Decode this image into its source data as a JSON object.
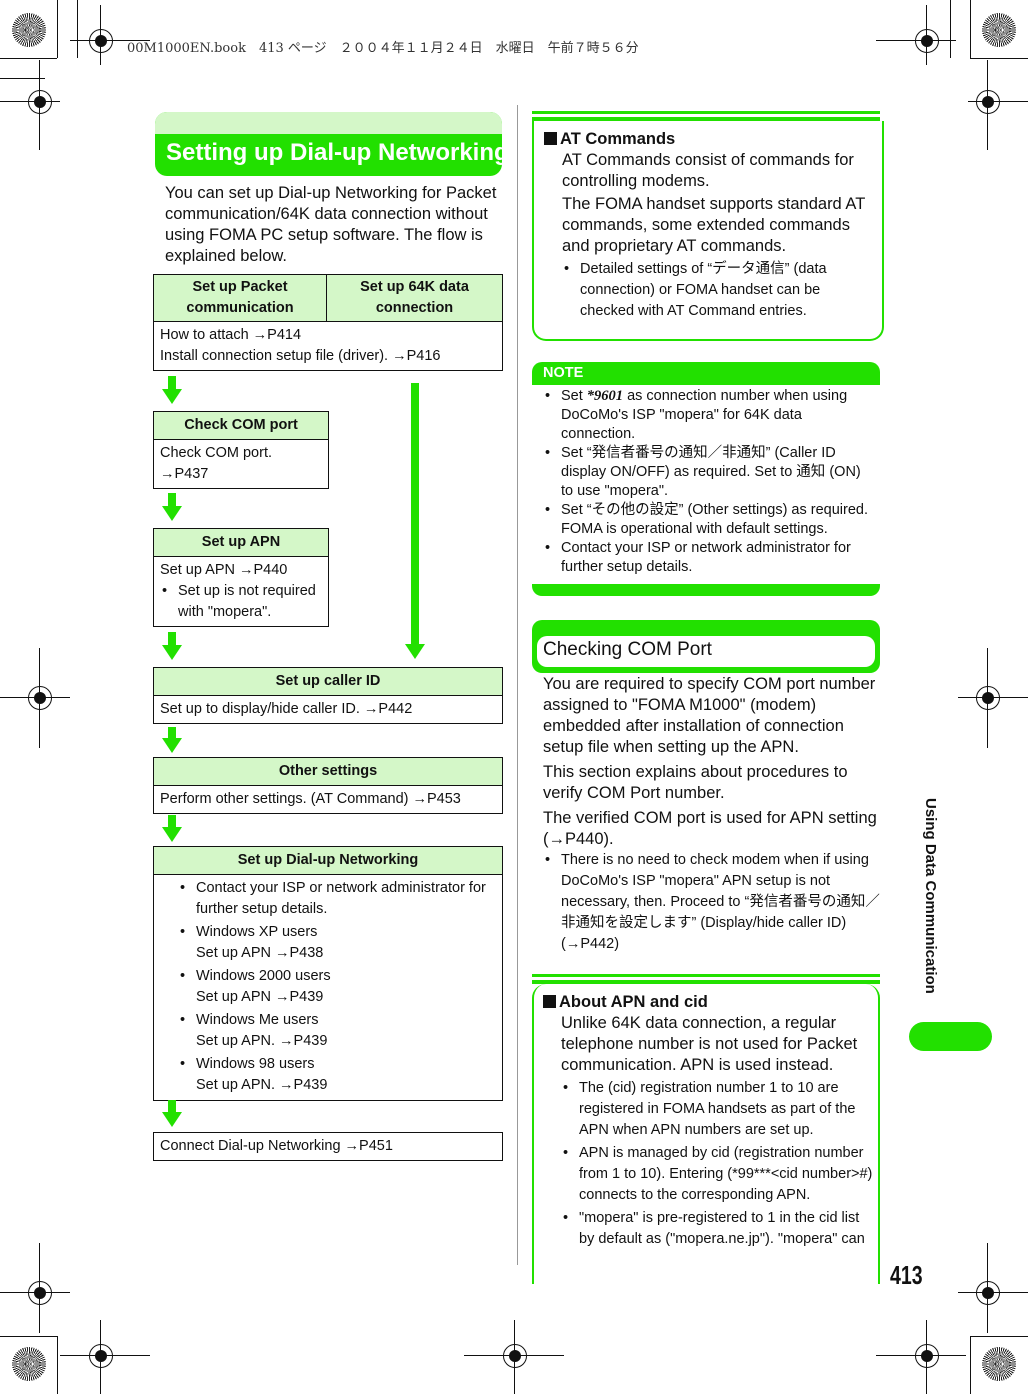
{
  "print_header": "00M1000EN.book　413 ページ　２００４年１１月２４日　水曜日　午前７時５６分",
  "title": "Setting up Dial-up Networking",
  "intro": "You can set up Dial-up Networking for Packet communication/64K data connection without using FOMA PC setup software. The flow is explained below.",
  "flow": {
    "start": {
      "col1": "Set up Packet communication",
      "col2": "Set up 64K data connection",
      "lines": [
        "How to attach →P414",
        "Install connection setup file (driver). →P416"
      ]
    },
    "com": {
      "head": "Check COM port",
      "lines": [
        "Check COM port.",
        "→P437"
      ]
    },
    "apn": {
      "head": "Set up APN",
      "line": "Set up APN →P440",
      "bullet": "Set up is not required with \"mopera\"."
    },
    "caller": {
      "head": "Set up caller ID",
      "line": "Set up to display/hide caller ID. →P442"
    },
    "other": {
      "head": "Other settings",
      "line": "Perform other settings. (AT Command) →P453"
    },
    "dialup": {
      "head": "Set up Dial-up Networking",
      "items": [
        {
          "a": "Contact your ISP or network administrator for further setup details.",
          "b": ""
        },
        {
          "a": "Windows XP users",
          "b": "Set up APN →P438"
        },
        {
          "a": "Windows 2000 users",
          "b": "Set up APN →P439"
        },
        {
          "a": "Windows Me users",
          "b": "Set up APN. →P439"
        },
        {
          "a": "Windows 98 users",
          "b": "Set up APN. →P439"
        }
      ]
    },
    "connect": "Connect Dial-up Networking →P451"
  },
  "at": {
    "head": "AT Commands",
    "p1": "AT Commands consist of commands for controlling modems.",
    "p2": "The FOMA handset supports standard AT commands, some extended commands and proprietary AT commands.",
    "bullet": "Detailed settings of “データ通信” (data connection) or FOMA handset can be checked with AT Command entries."
  },
  "note": {
    "label": "NOTE",
    "b1_pre": "Set ",
    "b1_code": "*9601",
    "b1_post": " as connection number when using DoCoMo's ISP \"mopera\" for 64K data connection.",
    "b2": "Set “発信者番号の通知／非通知” (Caller ID display ON/OFF) as required. Set to 通知 (ON) to use \"mopera\".",
    "b3": "Set “その他の設定” (Other settings) as required. FOMA is operational with default settings.",
    "b4": "Contact your ISP or network administrator for further setup details."
  },
  "com_section": {
    "title": "Checking COM Port",
    "p1": "You are required to specify COM port number assigned to \"FOMA M1000\" (modem) embedded after installation of connection setup file when setting up the APN.",
    "p2": "This section explains about procedures to verify COM Port number.",
    "p3": "The verified COM port is used for APN setting (→P440).",
    "bullet": "There is no need to check modem when if using DoCoMo's ISP \"mopera\" APN setup is not necessary, then. Proceed to “発信者番号の通知／非通知を設定します” (Display/hide caller ID) (→P442)"
  },
  "apn_cid": {
    "head": "About APN and cid",
    "p1": "Unlike 64K data connection, a regular telephone number is not used for Packet communication. APN is used instead.",
    "b1": "The (cid) registration number 1 to 10 are registered in FOMA handsets as part of the APN when APN numbers are set up.",
    "b2": "APN is managed by cid (registration number from 1 to 10). Entering (*99***<cid number>#) connects to the corresponding APN.",
    "b3": "\"mopera\" is pre-registered to 1 in the cid list by default as (\"mopera.ne.jp\"). \"mopera\" can"
  },
  "side_tab": "Using Data Communication",
  "page_number": "413",
  "colors": {
    "accent": "#22e000",
    "light": "#d4f7c8"
  }
}
